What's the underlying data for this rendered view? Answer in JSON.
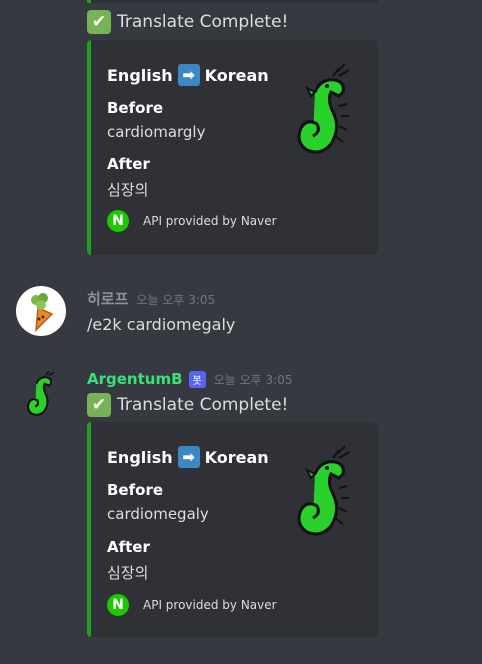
{
  "messages": [
    {
      "complete_text": "Translate Complete!",
      "embed": {
        "title_left": "English",
        "title_right": "Korean",
        "before_label": "Before",
        "before_value": "cardiomargly",
        "after_label": "After",
        "after_value": "심장의",
        "footer": "API provided by Naver"
      }
    },
    {
      "username": "히로프",
      "timestamp": "오늘 오후 3:05",
      "text": "/e2k cardiomegaly",
      "username_color": "#8e9297"
    },
    {
      "username": "ArgentumB",
      "bot_tag": "봇",
      "timestamp": "오늘 오후 3:05",
      "username_color": "#3ce07a",
      "complete_text": "Translate Complete!",
      "embed": {
        "title_left": "English",
        "title_right": "Korean",
        "before_label": "Before",
        "before_value": "cardiomegaly",
        "after_label": "After",
        "after_value": "심장의",
        "footer": "API provided by Naver"
      }
    }
  ],
  "icons": {
    "check": "✔",
    "arrow": "➡",
    "naver": "N"
  },
  "colors": {
    "background": "#36393f",
    "embed_bg": "#2f3136",
    "embed_border": "#1fa01f",
    "naver_green": "#1ec800"
  }
}
